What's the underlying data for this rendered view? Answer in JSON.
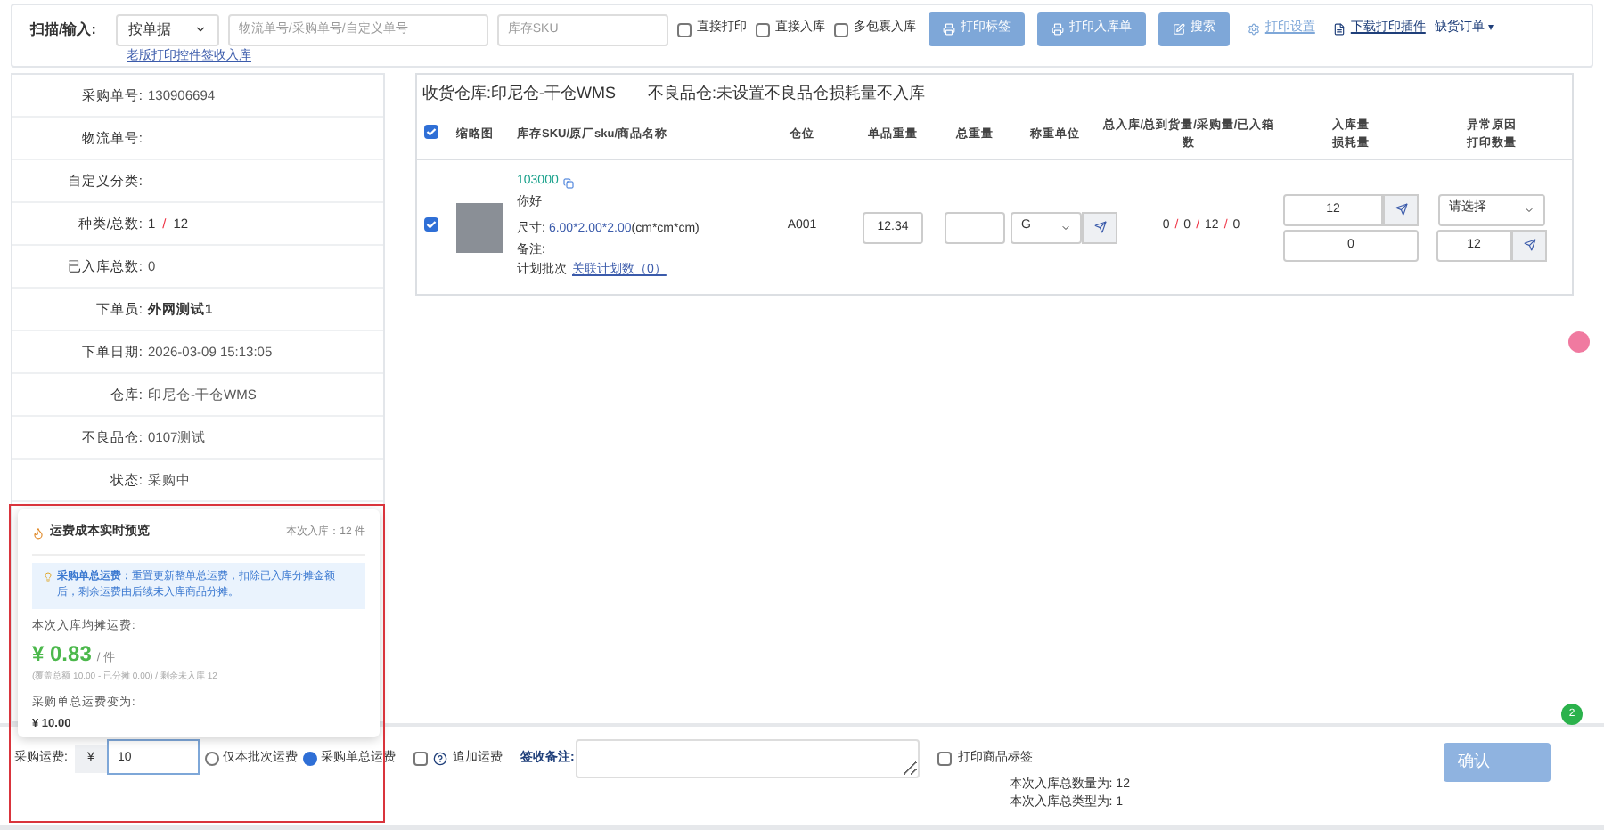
{
  "toolbar": {
    "scan_label": "扫描/输入:",
    "mode_select": "按单据",
    "tracking_field": {
      "placeholder": "物流单号/采购单号/自定义单号"
    },
    "sku_field": {
      "placeholder": "库存SKU"
    },
    "checkboxes": [
      {
        "label": "直接打印",
        "checked": false
      },
      {
        "label": "直接入库",
        "checked": false
      },
      {
        "label": "多包裹入库",
        "checked": false
      }
    ],
    "buttons": [
      {
        "kind": "print",
        "label": "打印标签"
      },
      {
        "kind": "print",
        "label": "打印入库单"
      },
      {
        "kind": "edit",
        "label": "搜索"
      }
    ],
    "links": [
      {
        "kind": "gear",
        "label": "打印设置"
      },
      {
        "kind": "file",
        "label": "下载打印插件"
      }
    ],
    "dropdown": "缺货订单",
    "dropdown_caret": "▾",
    "sub_link": "老版打印控件签收入库"
  },
  "details": [
    {
      "label": "采购单号:",
      "value": "130906694",
      "kind": "plain"
    },
    {
      "label": "物流单号:",
      "kind": "plain"
    },
    {
      "label": "自定义分类:",
      "kind": "plain"
    },
    {
      "label": "种类/总数:",
      "value": "1",
      "separator": "/",
      "value2": "12",
      "kind": "ratio"
    },
    {
      "label": "已入库总数:",
      "value": "0",
      "kind": "plain"
    },
    {
      "label": "下单员:",
      "value": "外网测试1",
      "kind": "bold"
    },
    {
      "label": "下单日期:",
      "value": "2026-03-09 15:13:05",
      "kind": "plain"
    },
    {
      "label": "仓库:",
      "value": "印尼仓-干仓WMS",
      "kind": "plain"
    },
    {
      "label": "不良品仓:",
      "value": "0107测试",
      "kind": "plain"
    },
    {
      "label": "状态:",
      "value": "采购中",
      "kind": "plain"
    }
  ],
  "receiving": {
    "warehouse_label": "收货仓库:",
    "warehouse": "印尼仓-干仓WMS",
    "defect_label": "不良品仓:",
    "defect": "未设置不良品仓损耗量不入库"
  },
  "table": {
    "all_checked": true,
    "columns": [
      [
        "缩略图"
      ],
      [
        "库存SKU/原厂sku/商品名称"
      ],
      [
        "仓位"
      ],
      [
        "单品重量"
      ],
      [
        "总重量"
      ],
      [
        "称重单位"
      ],
      [
        "总入库/总到货量/采购量/已入箱数"
      ],
      [
        "入库量",
        "损耗量"
      ],
      [
        "异常原因",
        "打印数量"
      ]
    ],
    "rows": [
      {
        "checked": true,
        "sku": "103000",
        "name": "你好",
        "size_label": "尺寸:",
        "size": "6.00*2.00*2.00",
        "size_unit": "(cm*cm*cm)",
        "remark": "备注:",
        "plan_label": "计划批次",
        "plan_link": "关联计划数（0）",
        "location": "A001",
        "unit_weight": "12.34",
        "total_weight": "",
        "weigh_unit": "G",
        "counts": [
          "0",
          "0",
          "12",
          "0"
        ],
        "count_separators": [
          "/",
          "/",
          "/"
        ],
        "inbound_qty": "12",
        "loss_qty": "0",
        "reason": "请选择",
        "print_qty": "12"
      }
    ]
  },
  "freight_popup": {
    "title": "运费成本实时预览",
    "inbound_note": "本次入库：12 件",
    "tip_title": "采购单总运费：",
    "tip_text": "重置更新整单总运费，扣除已入库分摊金额后，剩余运费由后续未入库商品分摊。",
    "avg_label": "本次入库均摊运费:",
    "avg_value": "¥ 0.83",
    "avg_unit": "/ 件",
    "formula": "(覆盖总额 10.00 - 已分摊 0.00) / 剩余未入库 12",
    "total_label": "采购单总运费变为:",
    "total_value": "¥ 10.00"
  },
  "bottom": {
    "freight_label": "采购运费:",
    "currency": "¥",
    "freight_value": "10",
    "freight_options": [
      {
        "label": "仅本批次运费",
        "selected": false
      },
      {
        "label": "采购单总运费",
        "selected": true
      }
    ],
    "extra_freight": {
      "label": "追加运费",
      "checked": false
    },
    "remark_label": "签收备注:",
    "print_label": {
      "label": "打印商品标签",
      "checked": false
    },
    "total_qty": "本次入库总数量为: 12",
    "total_types": "本次入库总类型为: 1",
    "confirm": "确认",
    "badge": "2"
  }
}
